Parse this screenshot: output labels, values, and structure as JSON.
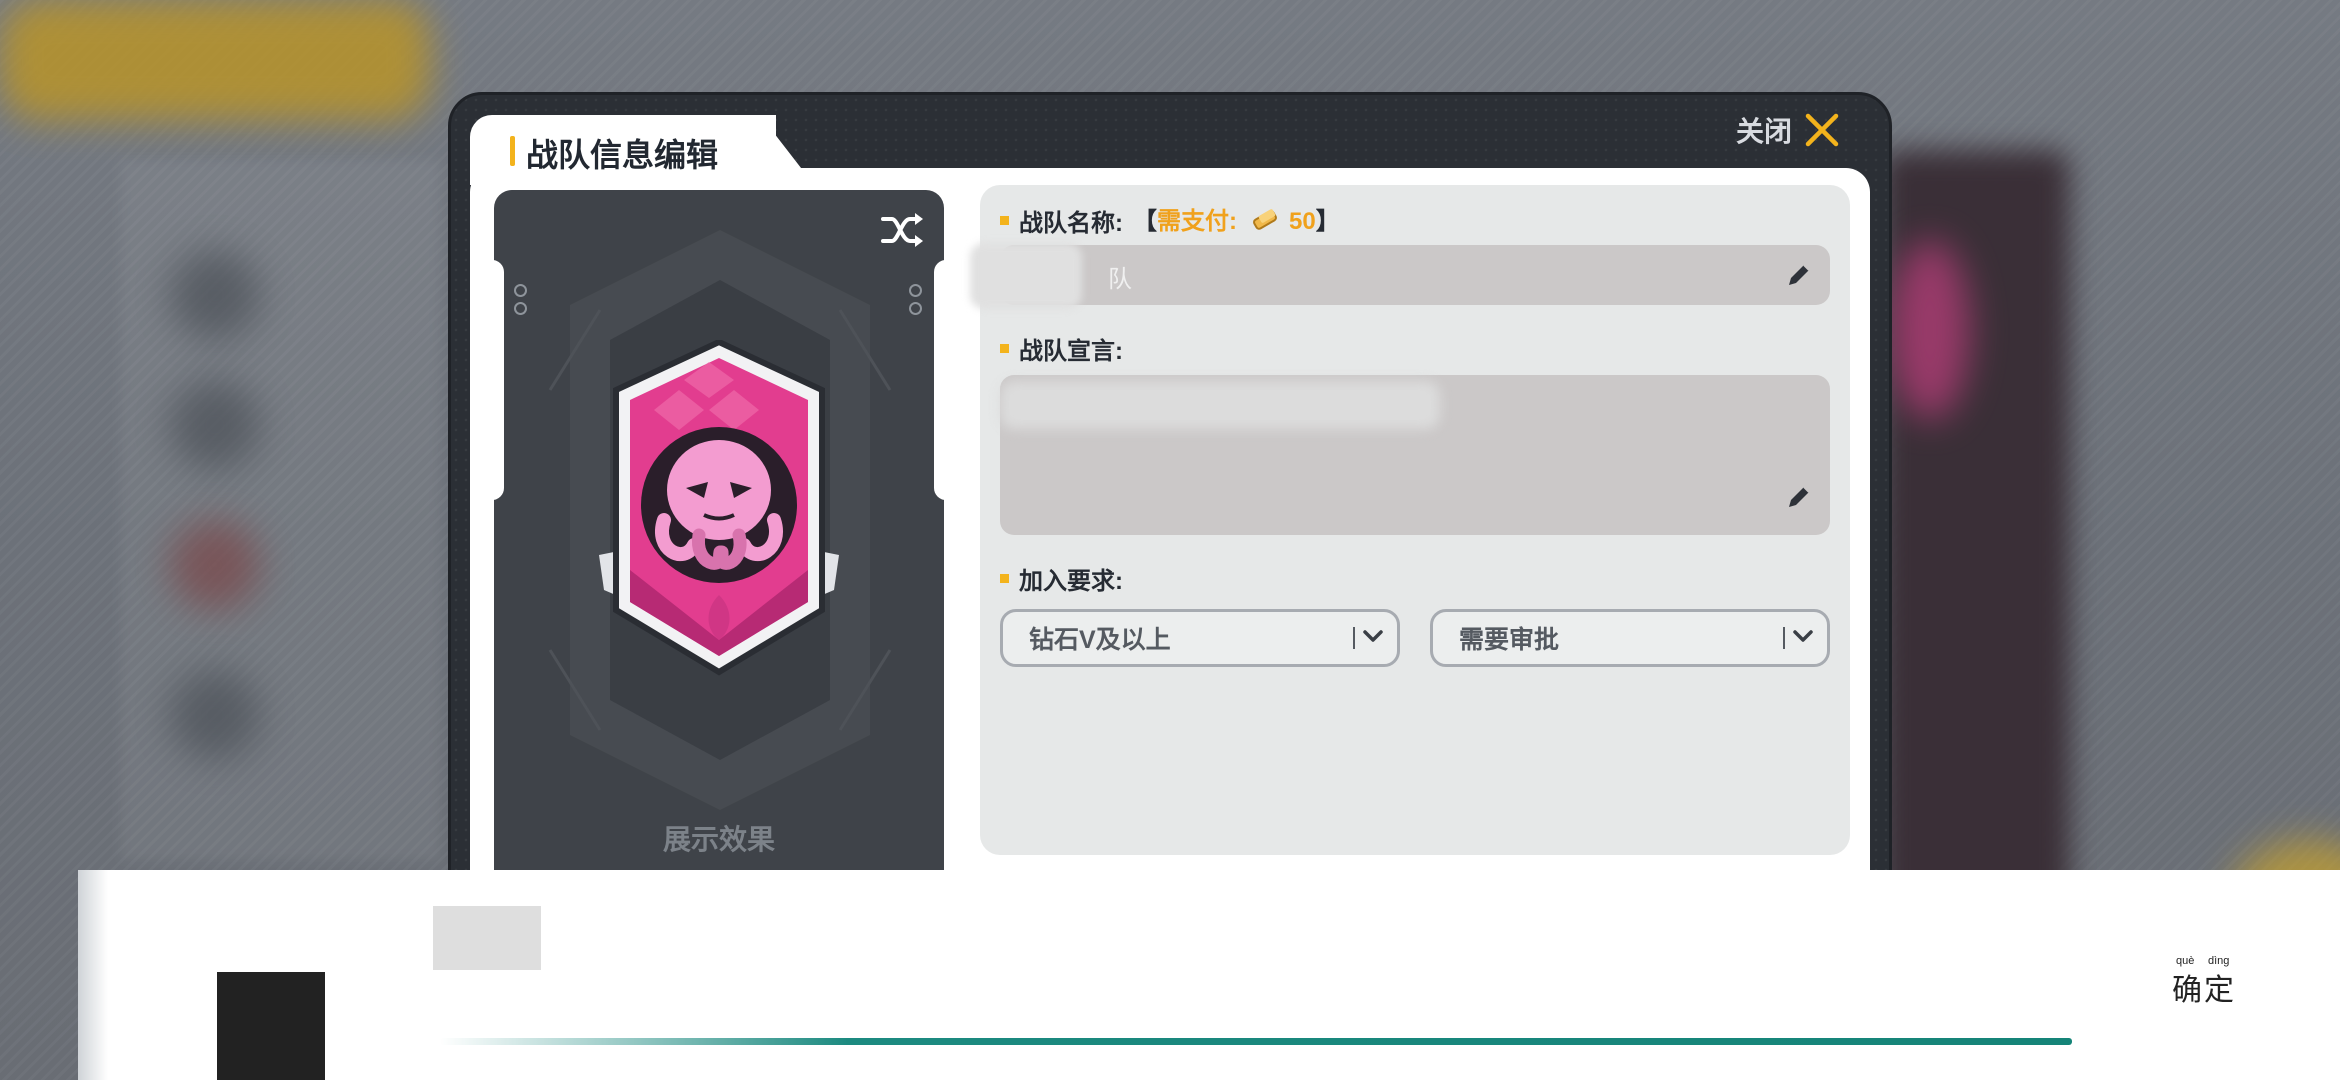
{
  "modal": {
    "title": "战队信息编辑",
    "close_label": "关闭"
  },
  "preview": {
    "caption": "展示效果",
    "shuffle_icon": "shuffle-icon",
    "emblem_icon": "octopus-emblem-icon"
  },
  "form": {
    "name": {
      "label": "战队名称:",
      "bracket_open": "【",
      "cost_label": "需支付:",
      "cost_amount": "50",
      "bracket_close": "】",
      "value": "队",
      "edit_icon": "pencil-icon"
    },
    "declaration": {
      "label": "战队宣言:",
      "value": "",
      "edit_icon": "pencil-icon"
    },
    "join": {
      "label": "加入要求:",
      "rank_value": "钻石V及以上",
      "approval_value": "需要审批"
    }
  },
  "bottom": {
    "confirm_pinyin_1": "què",
    "confirm_pinyin_2": "dìng",
    "confirm_char_1": "确",
    "confirm_char_2": "定"
  },
  "colors": {
    "accent_yellow": "#f3b31c",
    "cost_orange": "#f0a11c",
    "emblem_pink": "#e23d8f",
    "teal_progress": "#158478"
  }
}
